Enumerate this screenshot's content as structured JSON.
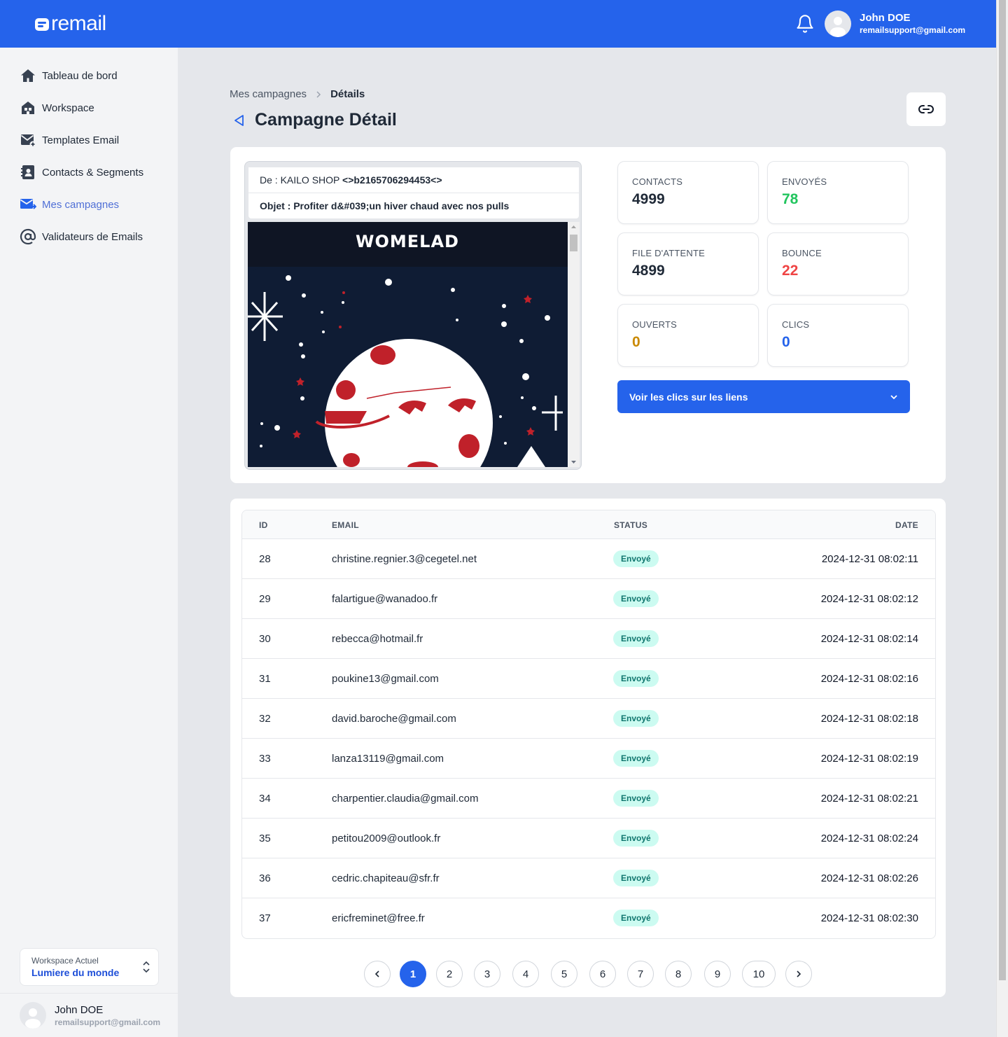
{
  "app": {
    "brand": "remail"
  },
  "topbar": {
    "user_name": "John DOE",
    "user_email": "remailsupport@gmail.com"
  },
  "sidebar": {
    "items": [
      {
        "label": "Tableau de bord",
        "icon": "home-icon"
      },
      {
        "label": "Workspace",
        "icon": "workspace-icon"
      },
      {
        "label": "Templates Email",
        "icon": "mail-plus-icon"
      },
      {
        "label": "Contacts & Segments",
        "icon": "contacts-icon"
      },
      {
        "label": "Mes campagnes",
        "icon": "mail-send-icon",
        "active": true
      },
      {
        "label": "Validateurs de Emails",
        "icon": "at-icon"
      }
    ],
    "workspace": {
      "label": "Workspace Actuel",
      "value": "Lumiere du monde"
    },
    "footer": {
      "name": "John DOE",
      "email": "remailsupport@gmail.com"
    }
  },
  "breadcrumb": {
    "parent": "Mes campagnes",
    "current": "Détails"
  },
  "page": {
    "title": "Campagne Détail"
  },
  "preview": {
    "from_label": "De : KAILO SHOP ",
    "from_address": "<>b2165706294453<>",
    "subject": "Objet : Profiter d&#039;un hiver chaud avec nos pulls",
    "banner_text": "WOMELAD"
  },
  "stats": {
    "contacts": {
      "label": "CONTACTS",
      "value": "4999"
    },
    "sent": {
      "label": "ENVOYÉS",
      "value": "78"
    },
    "queue": {
      "label": "FILE D'ATTENTE",
      "value": "4899"
    },
    "bounce": {
      "label": "BOUNCE",
      "value": "22"
    },
    "opened": {
      "label": "OUVERTS",
      "value": "0"
    },
    "clicks": {
      "label": "CLICS",
      "value": "0"
    }
  },
  "colors": {
    "primary": "#2563eb",
    "sent": "#22c55e",
    "bounce": "#ef4444",
    "opened": "#ca8a04",
    "clicks": "#2563eb",
    "badge_bg": "#ccfbf1",
    "badge_text": "#0f766e"
  },
  "clicks_button": {
    "label": "Voir les clics sur les liens"
  },
  "table": {
    "headers": {
      "id": "ID",
      "email": "EMAIL",
      "status": "STATUS",
      "date": "DATE"
    },
    "rows": [
      {
        "id": "28",
        "email": "christine.regnier.3@cegetel.net",
        "status": "Envoyé",
        "date": "2024-12-31 08:02:11"
      },
      {
        "id": "29",
        "email": "falartigue@wanadoo.fr",
        "status": "Envoyé",
        "date": "2024-12-31 08:02:12"
      },
      {
        "id": "30",
        "email": "rebecca@hotmail.fr",
        "status": "Envoyé",
        "date": "2024-12-31 08:02:14"
      },
      {
        "id": "31",
        "email": "poukine13@gmail.com",
        "status": "Envoyé",
        "date": "2024-12-31 08:02:16"
      },
      {
        "id": "32",
        "email": "david.baroche@gmail.com",
        "status": "Envoyé",
        "date": "2024-12-31 08:02:18"
      },
      {
        "id": "33",
        "email": "lanza13119@gmail.com",
        "status": "Envoyé",
        "date": "2024-12-31 08:02:19"
      },
      {
        "id": "34",
        "email": "charpentier.claudia@gmail.com",
        "status": "Envoyé",
        "date": "2024-12-31 08:02:21"
      },
      {
        "id": "35",
        "email": "petitou2009@outlook.fr",
        "status": "Envoyé",
        "date": "2024-12-31 08:02:24"
      },
      {
        "id": "36",
        "email": "cedric.chapiteau@sfr.fr",
        "status": "Envoyé",
        "date": "2024-12-31 08:02:26"
      },
      {
        "id": "37",
        "email": "ericfreminet@free.fr",
        "status": "Envoyé",
        "date": "2024-12-31 08:02:30"
      }
    ]
  },
  "pagination": {
    "pages": [
      "1",
      "2",
      "3",
      "4",
      "5",
      "6",
      "7",
      "8",
      "9",
      "10"
    ],
    "current": "1"
  }
}
